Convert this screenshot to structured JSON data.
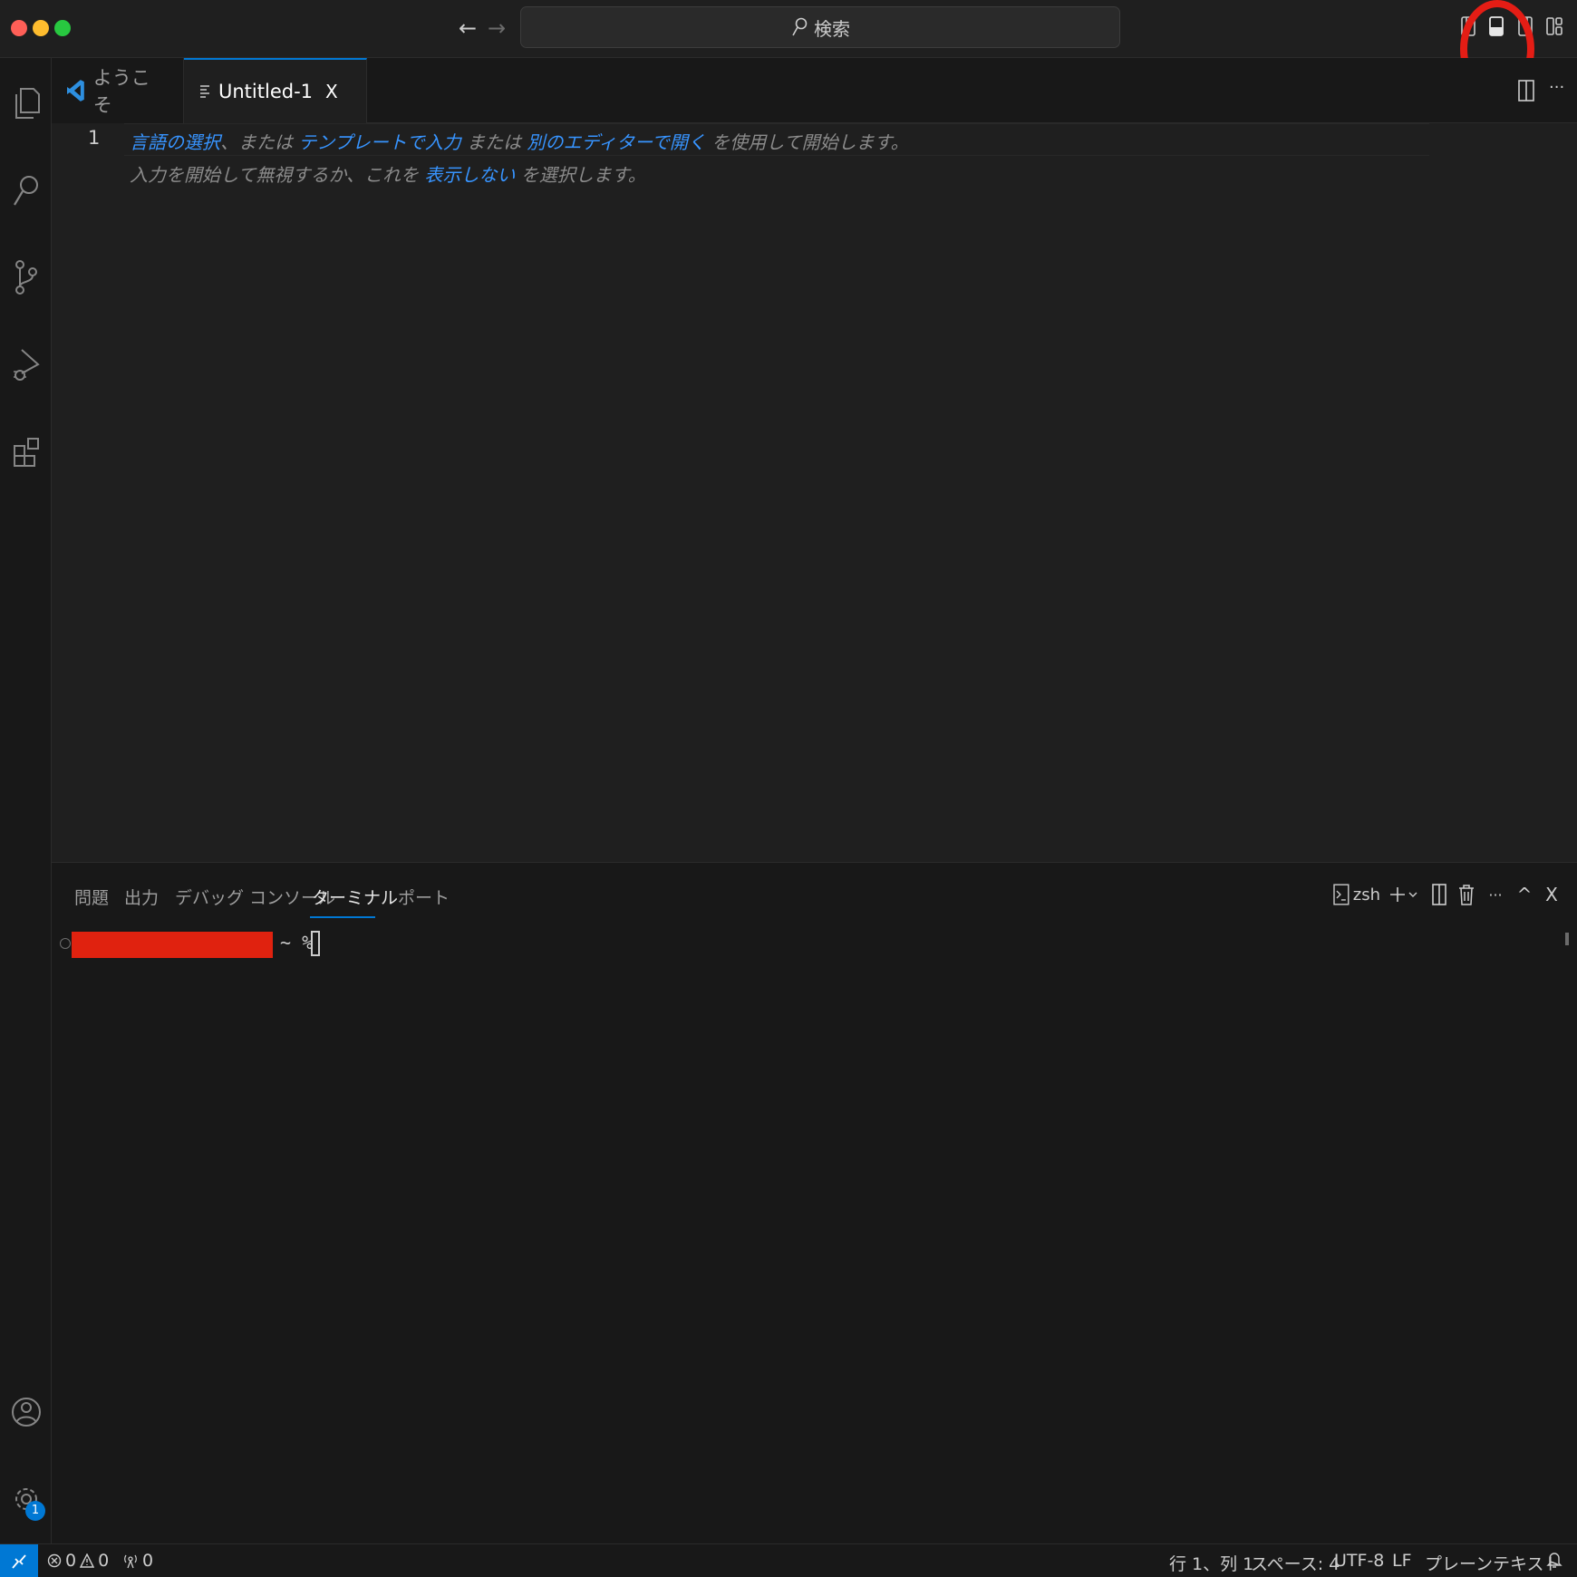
{
  "titlebar": {
    "search_label": "検索",
    "back_arrow": "←",
    "forward_arrow": "→"
  },
  "tabs": [
    {
      "label": "ようこそ",
      "active": false
    },
    {
      "label": "Untitled-1",
      "active": true,
      "close": "X"
    }
  ],
  "editor": {
    "line_number": "1",
    "hint_line1": {
      "link1": "言語の選択",
      "text1": "、または",
      "link2": "テンプレートで入力",
      "text2": "または",
      "link3": "別のエディターで開く",
      "text3": "を使用して開始します。"
    },
    "hint_line2": {
      "text1": "入力を開始して無視するか、これを",
      "link1": "表示しない",
      "text2": "を選択します。"
    }
  },
  "panel": {
    "tabs": [
      "問題",
      "出力",
      "デバッグ コンソール",
      "ターミナル",
      "ポート"
    ],
    "active_tab": "ターミナル",
    "terminal_name": "zsh",
    "prompt": "~ %",
    "ellipsis": "···",
    "caret_up": "^",
    "close": "X"
  },
  "statusbar": {
    "errors": "0",
    "warnings": "0",
    "ports": "0",
    "position": "行 1、列 1",
    "spaces": "スペース: 4",
    "encoding": "UTF-8",
    "eol": "LF",
    "language": "プレーンテキスト"
  },
  "activity": {
    "settings_badge": "1"
  },
  "colors": {
    "accent": "#0078d4",
    "link": "#3794ff",
    "annotation_red": "#e41d15",
    "redaction": "#e0220f"
  }
}
